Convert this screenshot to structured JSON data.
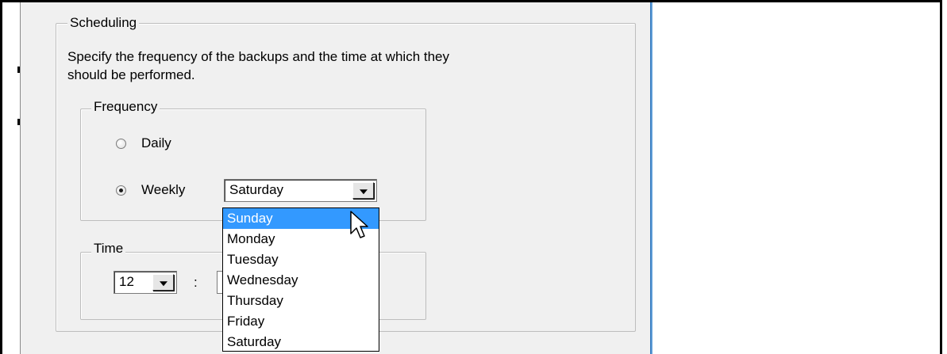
{
  "scheduling": {
    "legend": "Scheduling",
    "description_line1": "Specify the frequency of the backups and the time at which they",
    "description_line2": "should be performed."
  },
  "frequency": {
    "legend": "Frequency",
    "daily_label": "Daily",
    "weekly_label": "Weekly",
    "daily_selected": false,
    "weekly_selected": true,
    "day_combo_value": "Saturday",
    "day_options": [
      "Sunday",
      "Monday",
      "Tuesday",
      "Wednesday",
      "Thursday",
      "Friday",
      "Saturday"
    ],
    "highlighted_option": "Sunday"
  },
  "time": {
    "legend": "Time",
    "hour_value": "12",
    "separator": ":"
  },
  "colors": {
    "dialog_bg": "#f0f0f0",
    "selection": "#3399ff",
    "accent_edge": "#2a6fb7"
  },
  "icons": {
    "cursor": "arrow-pointer-icon",
    "dropdown_arrow": "chevron-down-icon"
  }
}
